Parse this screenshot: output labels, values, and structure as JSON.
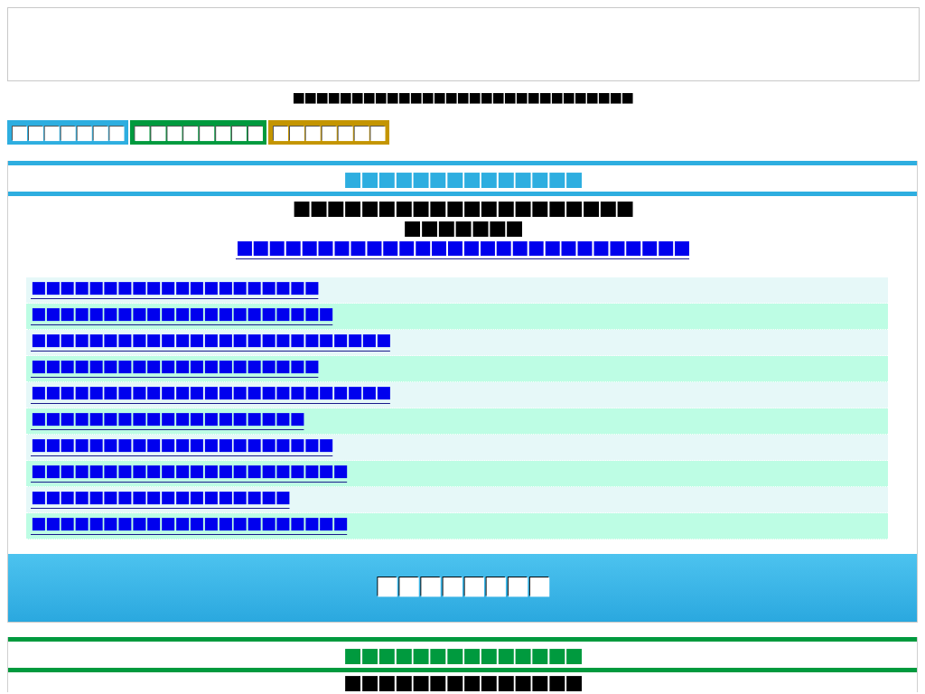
{
  "site_title": "■■■■■■■■■■■■■■■■■■■■■■■■■■■■■",
  "tabs": [
    {
      "label": "■■■■■■■",
      "color": "#2eaee0"
    },
    {
      "label": "■■■■■■■■",
      "color": "#009a3e"
    },
    {
      "label": "■■■■■■■",
      "color": "#c49500"
    }
  ],
  "sections": [
    {
      "title": "■■■■■■■■■■■■■■",
      "color": "#2eaee0",
      "headline_lines": [
        "■■■■■■■■■■■■■■■■■■■■",
        "■■■■■■■"
      ],
      "headline_link": "■■■■■■■■■■■■■■■■■■■■■■■■■■■■",
      "links": [
        "■■■■■■■■■■■■■■■■■■■■",
        "■■■■■■■■■■■■■■■■■■■■■",
        "■■■■■■■■■■■■■■■■■■■■■■■■■",
        "■■■■■■■■■■■■■■■■■■■■",
        "■■■■■■■■■■■■■■■■■■■■■■■■■",
        "■■■■■■■■■■■■■■■■■■■",
        "■■■■■■■■■■■■■■■■■■■■■",
        "■■■■■■■■■■■■■■■■■■■■■■",
        "■■■■■■■■■■■■■■■■■■",
        "■■■■■■■■■■■■■■■■■■■■■■"
      ],
      "banner": "■■■■■■■■"
    },
    {
      "title": "■■■■■■■■■■■■■■",
      "color": "#009a3e",
      "headline_lines": [
        "■■■■■■■■■■■■■■"
      ]
    }
  ]
}
